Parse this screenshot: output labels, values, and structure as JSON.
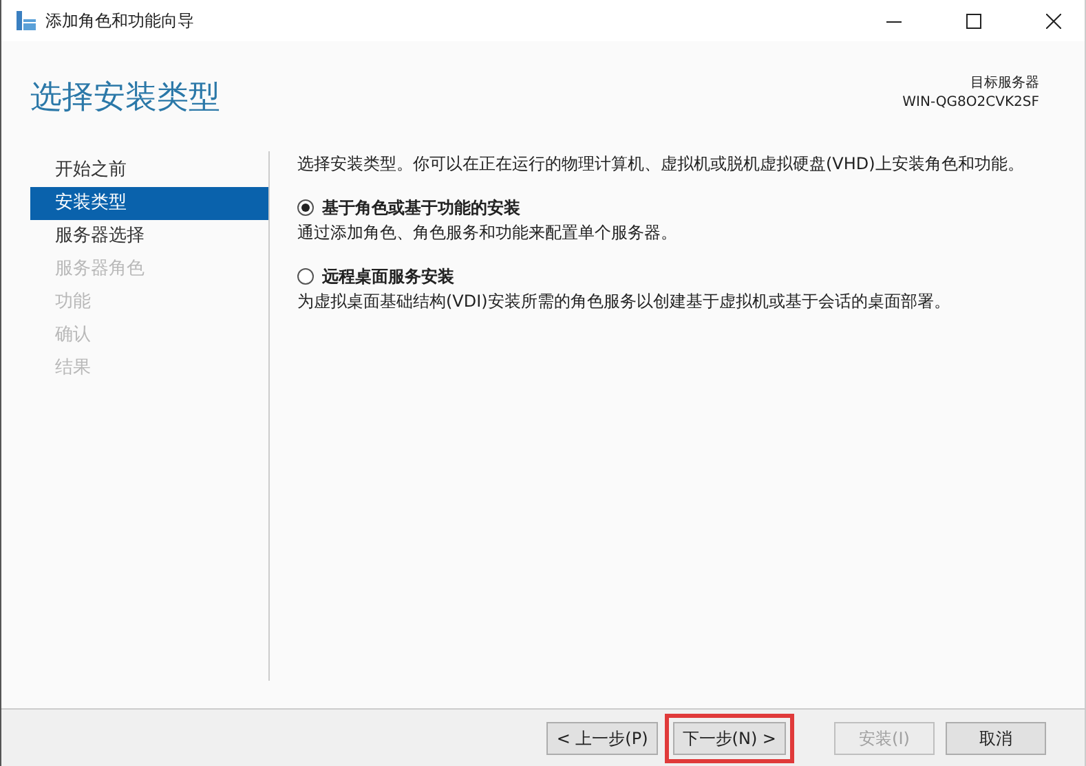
{
  "window": {
    "title": "添加角色和功能向导"
  },
  "header": {
    "title": "选择安装类型",
    "target_label": "目标服务器",
    "target_value": "WIN-QG8O2CVK2SF"
  },
  "steps": [
    {
      "label": "开始之前",
      "selected": false,
      "disabled": false
    },
    {
      "label": "安装类型",
      "selected": true,
      "disabled": false
    },
    {
      "label": "服务器选择",
      "selected": false,
      "disabled": false
    },
    {
      "label": "服务器角色",
      "selected": false,
      "disabled": true
    },
    {
      "label": "功能",
      "selected": false,
      "disabled": true
    },
    {
      "label": "确认",
      "selected": false,
      "disabled": true
    },
    {
      "label": "结果",
      "selected": false,
      "disabled": true
    }
  ],
  "intro": "选择安装类型。你可以在正在运行的物理计算机、虚拟机或脱机虚拟硬盘(VHD)上安装角色和功能。",
  "options": [
    {
      "label": "基于角色或基于功能的安装",
      "description": "通过添加角色、角色服务和功能来配置单个服务器。",
      "selected": true
    },
    {
      "label": "远程桌面服务安装",
      "description": "为虚拟桌面基础结构(VDI)安装所需的角色服务以创建基于虚拟机或基于会话的桌面部署。",
      "selected": false
    }
  ],
  "buttons": [
    {
      "label": "< 上一步(P)",
      "disabled": false,
      "highlighted": false
    },
    {
      "label": "下一步(N) >",
      "disabled": false,
      "highlighted": true
    },
    {
      "label": "安装(I)",
      "disabled": true,
      "highlighted": false
    },
    {
      "label": "取消",
      "disabled": false,
      "highlighted": false
    }
  ]
}
